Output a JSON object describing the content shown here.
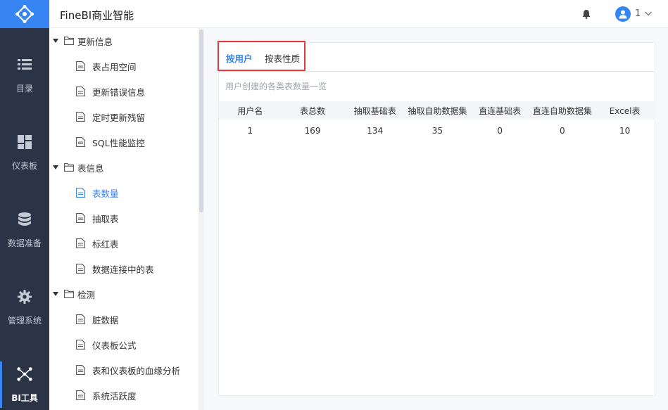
{
  "app": {
    "title": "FineBI商业智能"
  },
  "header": {
    "user_label": "1"
  },
  "rail": {
    "items": [
      {
        "label": "目录",
        "icon": "list-icon",
        "active": false
      },
      {
        "label": "仪表板",
        "icon": "dashboard-icon",
        "active": false
      },
      {
        "label": "数据准备",
        "icon": "database-icon",
        "active": false
      },
      {
        "label": "管理系统",
        "icon": "gear-icon",
        "active": false
      },
      {
        "label": "BI工具",
        "icon": "network-icon",
        "active": true
      }
    ]
  },
  "tree": {
    "groups": [
      {
        "label": "更新信息",
        "items": [
          "表占用空间",
          "更新错误信息",
          "定时更新残留",
          "SQL性能监控"
        ]
      },
      {
        "label": "表信息",
        "items": [
          "表数量",
          "抽取表",
          "标红表",
          "数据连接中的表"
        ]
      },
      {
        "label": "检测",
        "items": [
          "脏数据",
          "仪表板公式",
          "表和仪表板的血缘分析",
          "系统活跃度"
        ]
      }
    ],
    "active_item": "表数量"
  },
  "main": {
    "tabs": [
      {
        "label": "按用户",
        "active": true
      },
      {
        "label": "按表性质",
        "active": false
      }
    ],
    "subtitle": "用户创建的各类表数量一览",
    "table": {
      "columns": [
        "用户名",
        "表总数",
        "抽取基础表",
        "抽取自助数据集",
        "直连基础表",
        "直连自助数据集",
        "Excel表"
      ],
      "rows": [
        [
          "1",
          "169",
          "134",
          "35",
          "0",
          "0",
          "10"
        ]
      ]
    }
  },
  "colors": {
    "accent": "#3685f2",
    "rail_bg": "#2b3447",
    "highlight": "#e0383e"
  }
}
